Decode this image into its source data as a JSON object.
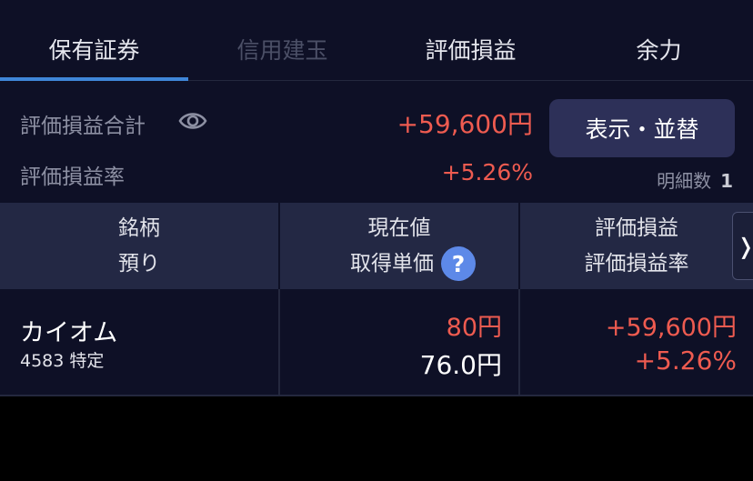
{
  "tabs": [
    {
      "label": "保有証券",
      "state": "active"
    },
    {
      "label": "信用建玉",
      "state": "disabled"
    },
    {
      "label": "評価損益",
      "state": "normal"
    },
    {
      "label": "余力",
      "state": "normal"
    }
  ],
  "summary": {
    "total_label": "評価損益合計",
    "total_value": "+59,600円",
    "rate_label": "評価損益率",
    "rate_value": "+5.26%",
    "sort_button": "表示・並替",
    "count_label": "明細数",
    "count_value": "1"
  },
  "table": {
    "headers": [
      {
        "line1": "銘柄",
        "line2": "預り"
      },
      {
        "line1": "現在値",
        "line2": "取得単価"
      },
      {
        "line1": "評価損益",
        "line2": "評価損益率"
      }
    ],
    "rows": [
      {
        "name": "カイオム",
        "code_type": "4583 特定",
        "current_price": "80円",
        "acquisition_price": "76.0円",
        "pl": "+59,600円",
        "pl_rate": "+5.26%"
      }
    ]
  },
  "icons": {
    "eye": "eye-icon",
    "help": "question-circle-icon",
    "next": "chevron-right-icon"
  },
  "colors": {
    "positive": "#ee5b50",
    "accent": "#3f86d8",
    "button_bg": "#2d3058",
    "panel_bg": "#0e1026",
    "header_bg": "#232844"
  }
}
